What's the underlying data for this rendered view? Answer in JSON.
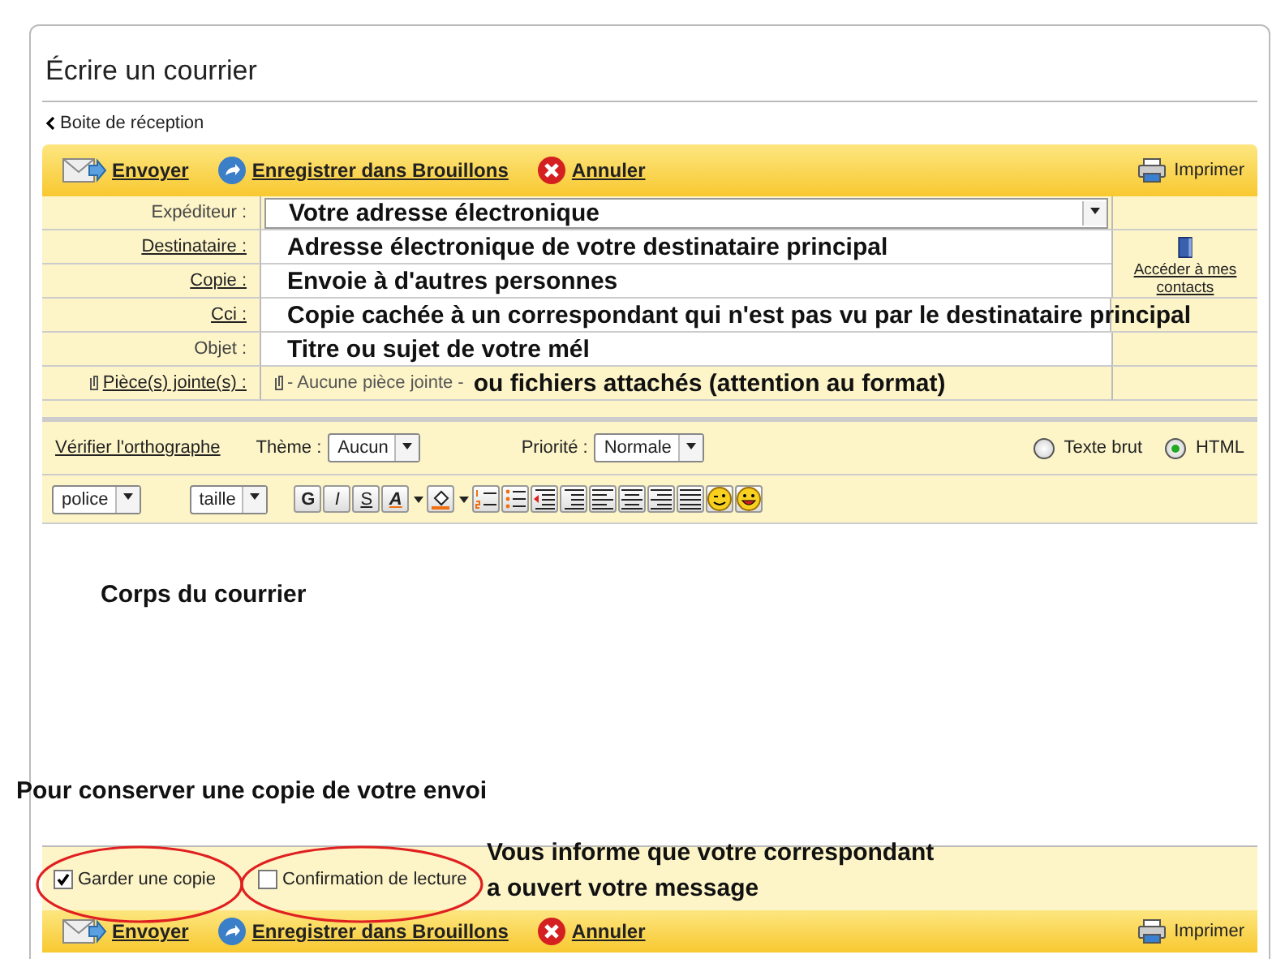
{
  "window": {
    "title": "Écrire un courrier"
  },
  "back_link": "Boite de réception",
  "toolbar": {
    "actions": [
      {
        "kind": "send",
        "label": "Envoyer"
      },
      {
        "kind": "draft",
        "label": "Enregistrer dans Brouillons"
      },
      {
        "kind": "cancel",
        "label": "Annuler"
      }
    ],
    "print": "Imprimer"
  },
  "fields": [
    {
      "label": "Expéditeur :",
      "kind": "select",
      "link": false,
      "value": "Votre adresse électronique"
    },
    {
      "label": "Destinataire :",
      "kind": "text",
      "link": true,
      "value": "Adresse électronique de votre destinataire principal"
    },
    {
      "label": "Copie :",
      "kind": "text",
      "link": true,
      "value": "Envoie à d'autres personnes"
    },
    {
      "label": "Cci :",
      "kind": "text",
      "link": true,
      "value": "Copie cachée à un correspondant qui n'est pas vu par le destinataire principal"
    },
    {
      "label": "Objet :",
      "kind": "text",
      "link": false,
      "value": "Titre ou sujet de votre mél"
    },
    {
      "label": "Pièce(s) jointe(s) :",
      "kind": "attachment",
      "link": true,
      "note": "- Aucune pièce jointe -",
      "value": "ou fichiers attachés (attention au format)"
    }
  ],
  "contacts_link": "Accéder à mes contacts",
  "options": {
    "spellcheck": "Vérifier l'orthographe",
    "theme_label": "Thème :",
    "theme": "Aucun",
    "priority_label": "Priorité :",
    "priority": "Normale",
    "formats": [
      {
        "label": "Texte brut",
        "selected": false
      },
      {
        "label": "HTML",
        "selected": true
      }
    ]
  },
  "editor": {
    "font": "police",
    "size": "taille",
    "buttons": [
      {
        "kind": "bold",
        "label": "G"
      },
      {
        "kind": "italic",
        "label": "I"
      },
      {
        "kind": "underline",
        "label": "S"
      },
      {
        "kind": "text-color",
        "label": "A"
      },
      {
        "kind": "highlight"
      },
      {
        "kind": "numbered-list"
      },
      {
        "kind": "bullet-list"
      },
      {
        "kind": "outdent"
      },
      {
        "kind": "indent"
      },
      {
        "kind": "align-left"
      },
      {
        "kind": "align-center"
      },
      {
        "kind": "align-right"
      },
      {
        "kind": "justify"
      },
      {
        "kind": "wink"
      },
      {
        "kind": "smiley"
      }
    ]
  },
  "body_note": "Corps du courrier",
  "copy_note": "Pour conserver une copie de votre envoi",
  "receipt_note": [
    "Vous informe que votre correspondant",
    "a ouvert votre message"
  ],
  "footer_options": [
    {
      "label": "Garder une copie",
      "checked": true,
      "circled": true
    },
    {
      "label": "Confirmation de lecture",
      "checked": false,
      "circled": true
    }
  ],
  "bottom_toolbar": {
    "actions": [
      {
        "kind": "send",
        "label": "Envoyer"
      },
      {
        "kind": "draft",
        "label": "Enregistrer dans Brouillons"
      },
      {
        "kind": "cancel",
        "label": "Annuler"
      }
    ],
    "print": "Imprimer"
  }
}
